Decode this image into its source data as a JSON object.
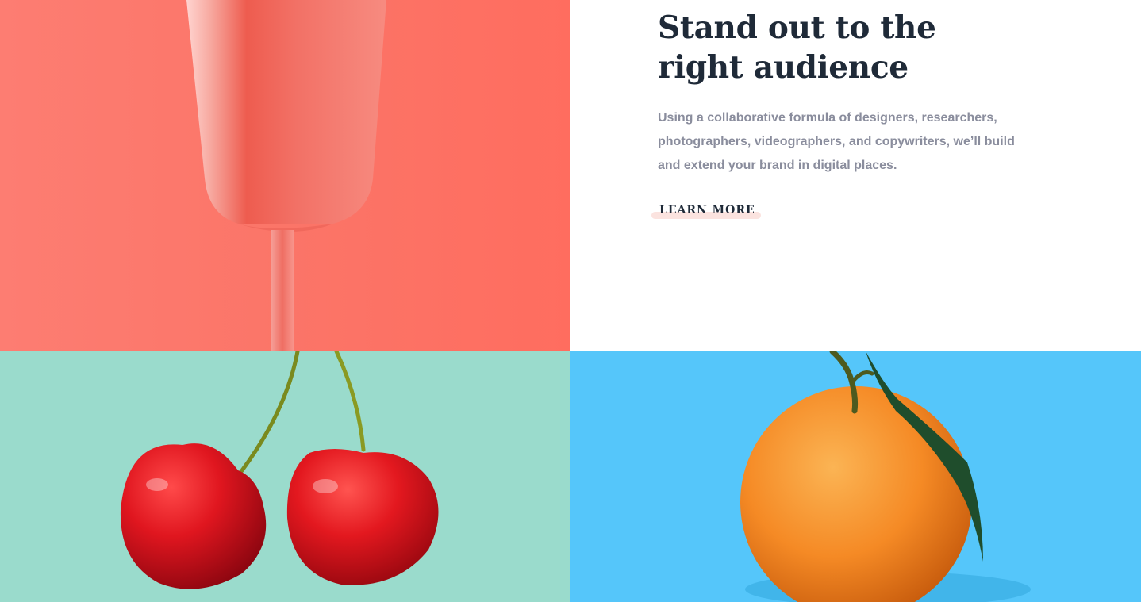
{
  "feature": {
    "heading": "Stand out to the right audience",
    "description": "Using a collaborative formula of designers, researchers, photographers, videographers, and copywriters, we’ll build and extend your brand in digital places.",
    "cta_label": "LEARN MORE"
  },
  "colors": {
    "coral": "#ff6f61",
    "teal": "#9adbcc",
    "sky_blue": "#55c6fa",
    "heading": "#1f2a38",
    "body_text": "#8a8d9d",
    "cta_underline": "#fbe3df"
  }
}
